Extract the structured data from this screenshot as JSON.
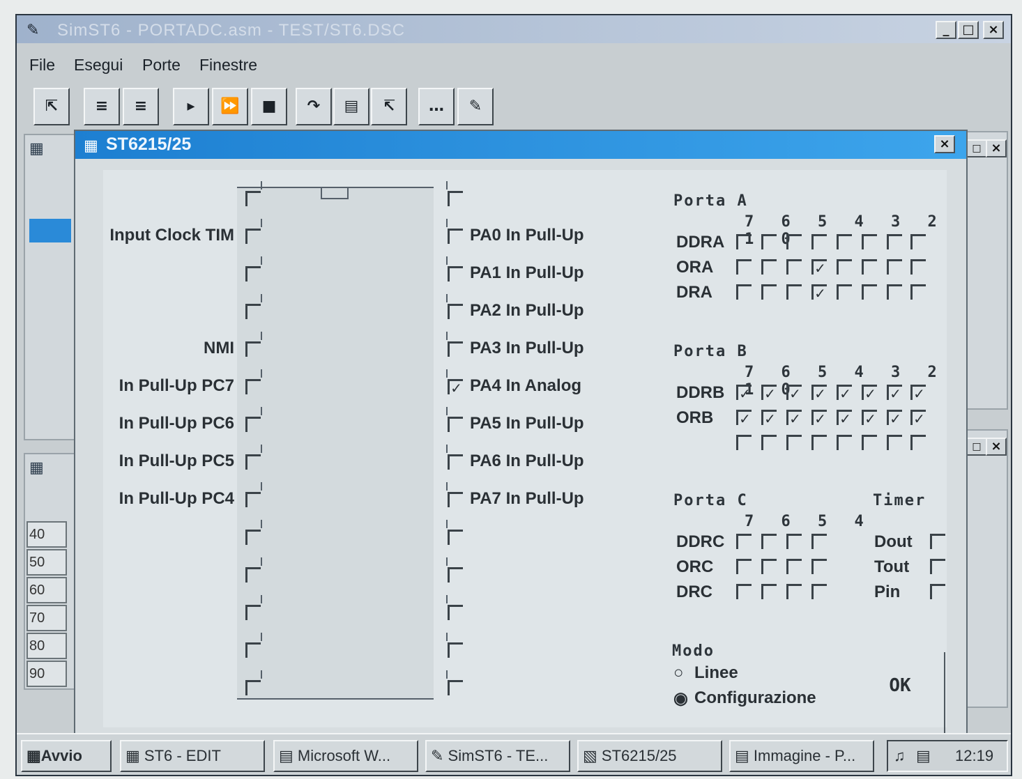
{
  "window": {
    "title": "SimST6 - PORTADC.asm - TEST/ST6.DSC",
    "min": "_",
    "max": "□",
    "close": "×"
  },
  "menu": [
    "File",
    "Esegui",
    "Porte",
    "Finestre"
  ],
  "toolbar_icons": [
    "open-icon",
    "step-into-icon",
    "step-out-icon",
    "run-icon",
    "fast-run-icon",
    "stop-icon",
    "step-over-icon",
    "break-icon",
    "trace-icon",
    "watch-icon",
    "tag-icon"
  ],
  "left_list": [
    "40",
    "50",
    "60",
    "70",
    "80",
    "90"
  ],
  "dialog": {
    "title": "ST6215/25",
    "close": "×",
    "left_pins": [
      {
        "label": "",
        "checked": false
      },
      {
        "label": "Input Clock  TIM",
        "checked": false
      },
      {
        "label": "",
        "checked": false
      },
      {
        "label": "",
        "checked": false
      },
      {
        "label": "NMI",
        "checked": false
      },
      {
        "label": "In Pull-Up  PC7",
        "checked": false
      },
      {
        "label": "In Pull-Up  PC6",
        "checked": false
      },
      {
        "label": "In Pull-Up  PC5",
        "checked": false
      },
      {
        "label": "In Pull-Up  PC4",
        "checked": false
      },
      {
        "label": "",
        "checked": false
      },
      {
        "label": "",
        "checked": false
      },
      {
        "label": "",
        "checked": false
      },
      {
        "label": "",
        "checked": false
      },
      {
        "label": "",
        "checked": false
      }
    ],
    "right_pins": [
      {
        "label": "",
        "checked": false
      },
      {
        "label": "PA0 In Pull-Up",
        "checked": false
      },
      {
        "label": "PA1 In Pull-Up",
        "checked": false
      },
      {
        "label": "PA2 In Pull-Up",
        "checked": false
      },
      {
        "label": "PA3 In Pull-Up",
        "checked": false
      },
      {
        "label": "PA4 In Analog",
        "checked": true
      },
      {
        "label": "PA5 In Pull-Up",
        "checked": false
      },
      {
        "label": "PA6 In Pull-Up",
        "checked": false
      },
      {
        "label": "PA7 In Pull-Up",
        "checked": false
      },
      {
        "label": "",
        "checked": false
      },
      {
        "label": "",
        "checked": false
      },
      {
        "label": "",
        "checked": false
      },
      {
        "label": "",
        "checked": false
      },
      {
        "label": "",
        "checked": false
      }
    ],
    "porta_a": {
      "title": "Porta A",
      "bits": "7 6 5 4 3 2 1 0",
      "rows": [
        {
          "name": "DDRA",
          "bits": [
            false,
            false,
            false,
            false,
            false,
            false,
            false,
            false
          ]
        },
        {
          "name": "ORA",
          "bits": [
            false,
            false,
            false,
            true,
            false,
            false,
            false,
            false
          ]
        },
        {
          "name": "DRA",
          "bits": [
            false,
            false,
            false,
            true,
            false,
            false,
            false,
            false
          ]
        }
      ]
    },
    "porta_b": {
      "title": "Porta B",
      "bits": "7 6 5 4 3 2 1 0",
      "rows": [
        {
          "name": "DDRB",
          "bits": [
            true,
            true,
            true,
            true,
            true,
            true,
            true,
            true
          ]
        },
        {
          "name": "ORB",
          "bits": [
            true,
            true,
            true,
            true,
            true,
            true,
            true,
            true
          ]
        },
        {
          "name": "",
          "bits": [
            false,
            false,
            false,
            false,
            false,
            false,
            false,
            false
          ]
        }
      ]
    },
    "porta_c": {
      "title": "Porta C",
      "bits": "7 6 5 4",
      "rows": [
        {
          "name": "DDRC",
          "bits": [
            false,
            false,
            false,
            false
          ]
        },
        {
          "name": "ORC",
          "bits": [
            false,
            false,
            false,
            false
          ]
        },
        {
          "name": "DRC",
          "bits": [
            false,
            false,
            false,
            false
          ]
        }
      ]
    },
    "timer": {
      "title": "Timer",
      "rows": [
        {
          "name": "Dout",
          "checked": false
        },
        {
          "name": "Tout",
          "checked": false
        },
        {
          "name": "Pin",
          "checked": false
        }
      ]
    },
    "modo": {
      "title": "Modo",
      "options": [
        {
          "label": "Linee",
          "selected": false
        },
        {
          "label": "Configurazione",
          "selected": true
        }
      ]
    },
    "ok": "OK"
  },
  "taskbar": {
    "start": "Avvio",
    "tasks": [
      "ST6 - EDIT",
      "Microsoft W...",
      "SimST6 - TE...",
      "ST6215/25",
      "Immagine - P..."
    ],
    "clock": "12:19"
  }
}
